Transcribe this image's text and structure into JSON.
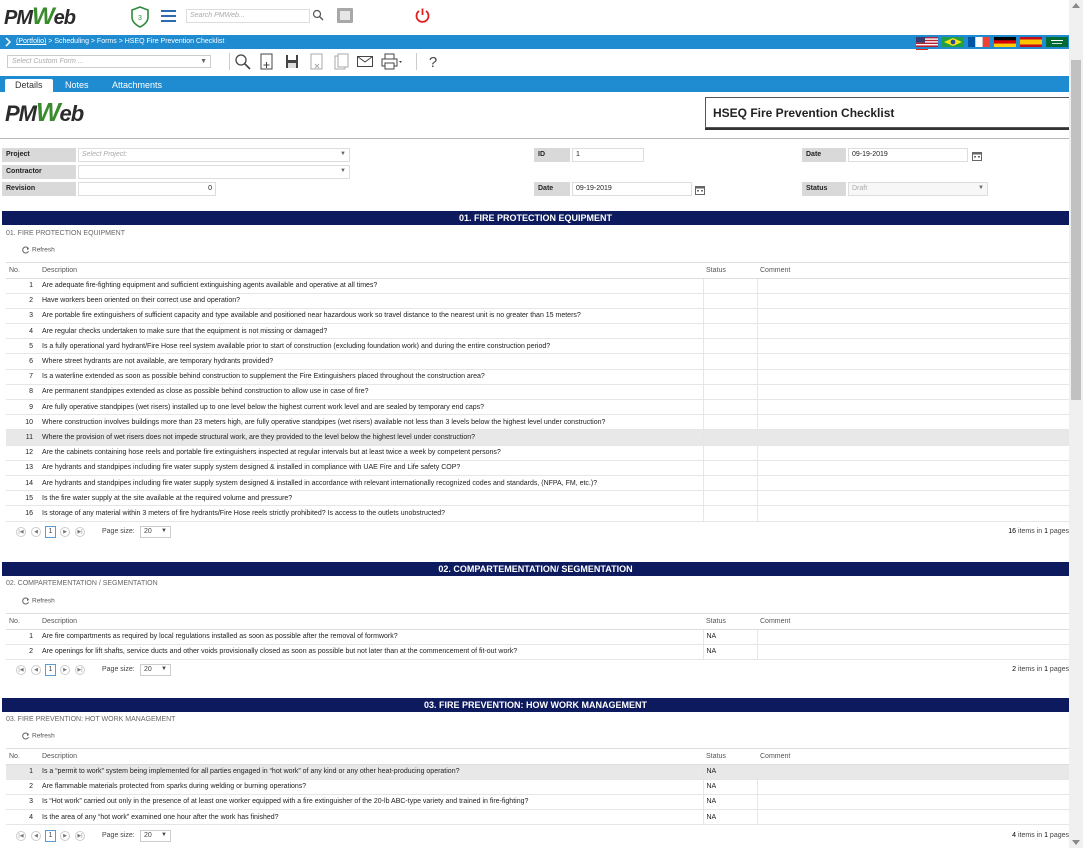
{
  "app": {
    "logo_text": "PMWeb",
    "notification_count": "3",
    "search_placeholder": "Search PMWeb...",
    "breadcrumb": {
      "portfolio": "(Portfolio)",
      "rest": " > Scheduling > Forms > HSEQ Fire Prevention Checklist"
    },
    "custom_form_placeholder": "Select Custom Form ..."
  },
  "tabs": [
    {
      "label": "Details"
    },
    {
      "label": "Notes"
    },
    {
      "label": "Attachments"
    }
  ],
  "doc": {
    "title": "HSEQ Fire Prevention Checklist"
  },
  "form": {
    "project_label": "Project",
    "project_placeholder": "Select Project:",
    "contractor_label": "Contractor",
    "revision_label": "Revision",
    "revision_value": "0",
    "id_label": "ID",
    "id_value": "1",
    "date_label_1": "Date",
    "date_value_1": "09-19-2019",
    "date_label_2": "Date",
    "date_value_2": "09-19-2019",
    "status_label": "Status",
    "status_value": "Draft"
  },
  "grid_columns": {
    "no": "No.",
    "description": "Description",
    "status": "Status",
    "comment": "Comment"
  },
  "refresh_label": "Refresh",
  "pager": {
    "page": "1",
    "page_size_label": "Page size:",
    "page_size": "20",
    "items_in": "items in",
    "pages": "pages"
  },
  "sections": [
    {
      "header": "01. FIRE PROTECTION EQUIPMENT",
      "sub": "01. FIRE PROTECTION EQUIPMENT",
      "count": "16",
      "page_count": "1",
      "rows": [
        {
          "no": "1",
          "desc": "Are adequate fire-fighting equipment and sufficient extinguishing agents available and operative at all times?",
          "status": ""
        },
        {
          "no": "2",
          "desc": "Have workers been oriented on their correct use and operation?",
          "status": ""
        },
        {
          "no": "3",
          "desc": "Are portable fire extinguishers of sufficient capacity and type available and positioned near hazardous work so travel distance to the nearest unit is no greater than 15 meters?",
          "status": ""
        },
        {
          "no": "4",
          "desc": "Are regular checks undertaken to make sure that the equipment is not missing or damaged?",
          "status": ""
        },
        {
          "no": "5",
          "desc": "Is a fully operational yard hydrant/Fire Hose reel system available prior to start of construction (excluding foundation work) and during the entire construction period?",
          "status": ""
        },
        {
          "no": "6",
          "desc": "Where street hydrants are not available, are temporary hydrants provided?",
          "status": ""
        },
        {
          "no": "7",
          "desc": "Is a waterline extended as soon as possible behind construction to supplement the Fire Extinguishers placed throughout the construction area?",
          "status": ""
        },
        {
          "no": "8",
          "desc": "Are permanent standpipes extended as close as possible behind construction to allow use in case of fire?",
          "status": ""
        },
        {
          "no": "9",
          "desc": "Are fully operative standpipes (wet risers) installed up to one level below the highest current work level and are sealed by temporary end caps?",
          "status": ""
        },
        {
          "no": "10",
          "desc": "Where construction involves buildings more than 23 meters high, are fully operative standpipes (wet risers) available not less than 3 levels below the highest level under construction?",
          "status": ""
        },
        {
          "no": "11",
          "desc": "Where the provision of wet risers does not impede structural work, are they provided to the level below the highest level under construction?",
          "status": ""
        },
        {
          "no": "12",
          "desc": "Are the cabinets containing hose reels and portable fire extinguishers inspected at regular intervals but at least twice a week by competent persons?",
          "status": ""
        },
        {
          "no": "13",
          "desc": "Are hydrants and standpipes including fire water supply system designed & installed in compliance with UAE Fire and Life safety COP?",
          "status": ""
        },
        {
          "no": "14",
          "desc": "Are hydrants and standpipes including fire water supply system designed & installed in accordance with relevant internationally recognized codes and standards, (NFPA, FM, etc.)?",
          "status": ""
        },
        {
          "no": "15",
          "desc": "Is the fire water supply at the site available at the required volume and pressure?",
          "status": ""
        },
        {
          "no": "16",
          "desc": "Is storage of any material within 3 meters of fire hydrants/Fire Hose reels strictly prohibited? Is access to the outlets unobstructed?",
          "status": ""
        }
      ]
    },
    {
      "header": "02. COMPARTEMENTATION/ SEGMENTATION",
      "sub": "02. COMPARTEMENTATION / SEGMENTATION",
      "count": "2",
      "page_count": "1",
      "rows": [
        {
          "no": "1",
          "desc": "Are fire compartments as required by local regulations installed as soon as possible after the removal of formwork?",
          "status": "NA"
        },
        {
          "no": "2",
          "desc": "Are openings for lift shafts, service ducts and other voids provisionally closed as soon as possible but not later than at the commencement of fit-out work?",
          "status": "NA"
        }
      ]
    },
    {
      "header": "03. FIRE PREVENTION: HOW WORK MANAGEMENT",
      "sub": "03. FIRE PREVENTION: HOT WORK MANAGEMENT",
      "count": "4",
      "page_count": "1",
      "rows": [
        {
          "no": "1",
          "desc": "Is a “permit to work” system being implemented for all parties engaged in “hot work” of any kind or any other heat-producing operation?",
          "status": "NA"
        },
        {
          "no": "2",
          "desc": "Are flammable materials protected from sparks during welding or burning operations?",
          "status": "NA"
        },
        {
          "no": "3",
          "desc": "Is “Hot work” carried out only in the presence of at least one worker equipped with a fire extinguisher of the 20-lb ABC-type variety and trained in fire-fighting?",
          "status": "NA"
        },
        {
          "no": "4",
          "desc": "Is the area of any “hot work” examined one hour after the work has finished?",
          "status": "NA"
        }
      ]
    }
  ],
  "colors": {
    "brand_blue": "#1f8bd0",
    "section_navy": "#0d1b5e",
    "logo_green": "#3a8a2e",
    "power_red": "#e02020"
  }
}
